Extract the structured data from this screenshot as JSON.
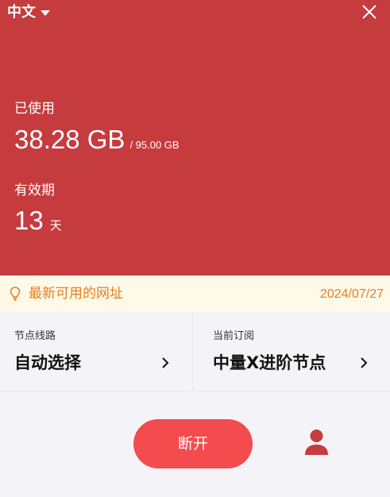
{
  "header": {
    "language_label": "中文",
    "language_icon": "caret-down-icon",
    "close_icon": "close-icon"
  },
  "usage": {
    "used_label": "已使用",
    "used_value": "38.28 GB",
    "used_total": "/ 95.00 GB",
    "valid_label": "有效期",
    "valid_value": "13",
    "valid_unit": "天"
  },
  "notice": {
    "icon": "lightbulb-icon",
    "text": "最新可用的网址",
    "date": "2024/07/27"
  },
  "selectors": {
    "node_label": "节点线路",
    "node_value": "自动选择",
    "subscription_label": "当前订阅",
    "subscription_value": "中量X进阶节点"
  },
  "actions": {
    "disconnect_label": "断开",
    "user_icon": "user-icon"
  },
  "colors": {
    "panel_red": "#c63b3d",
    "button_red": "#f44b4f",
    "notice_bg": "#fff9e8",
    "notice_text": "#e67e22",
    "background": "#f4f4f8"
  }
}
